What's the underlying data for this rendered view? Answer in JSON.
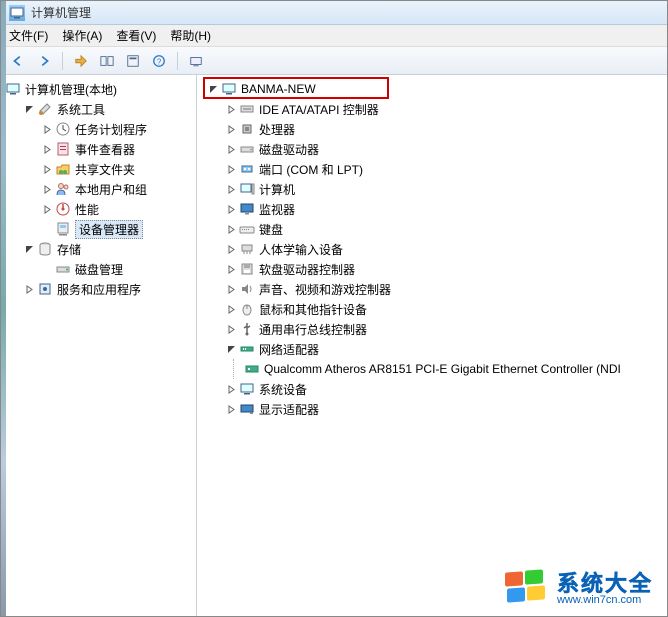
{
  "window": {
    "title": "计算机管理"
  },
  "menu": {
    "file": "文件(F)",
    "action": "操作(A)",
    "view": "查看(V)",
    "help": "帮助(H)"
  },
  "toolbar": {
    "back": "back",
    "forward": "forward",
    "up": "up",
    "showhide": "showhide",
    "properties": "properties",
    "help": "help",
    "refresh": "refresh"
  },
  "leftTree": {
    "root": "计算机管理(本地)",
    "systemTools": "系统工具",
    "taskScheduler": "任务计划程序",
    "eventViewer": "事件查看器",
    "sharedFolders": "共享文件夹",
    "localUsers": "本地用户和组",
    "performance": "性能",
    "deviceManager": "设备管理器",
    "storage": "存储",
    "diskMgmt": "磁盘管理",
    "services": "服务和应用程序"
  },
  "rightTree": {
    "root": "BANMA-NEW",
    "ide": "IDE ATA/ATAPI 控制器",
    "cpu": "处理器",
    "diskDrives": "磁盘驱动器",
    "ports": "端口 (COM 和 LPT)",
    "computer": "计算机",
    "monitors": "监视器",
    "keyboards": "键盘",
    "hid": "人体学输入设备",
    "floppyCtrl": "软盘驱动器控制器",
    "sound": "声音、视频和游戏控制器",
    "mice": "鼠标和其他指针设备",
    "usb": "通用串行总线控制器",
    "network": "网络适配器",
    "nic1": "Qualcomm Atheros AR8151 PCI-E Gigabit Ethernet Controller (NDI",
    "systemDevices": "系统设备",
    "displayAdapters": "显示适配器"
  },
  "watermark": {
    "big": "系统大全",
    "url": "www.win7cn.com"
  }
}
